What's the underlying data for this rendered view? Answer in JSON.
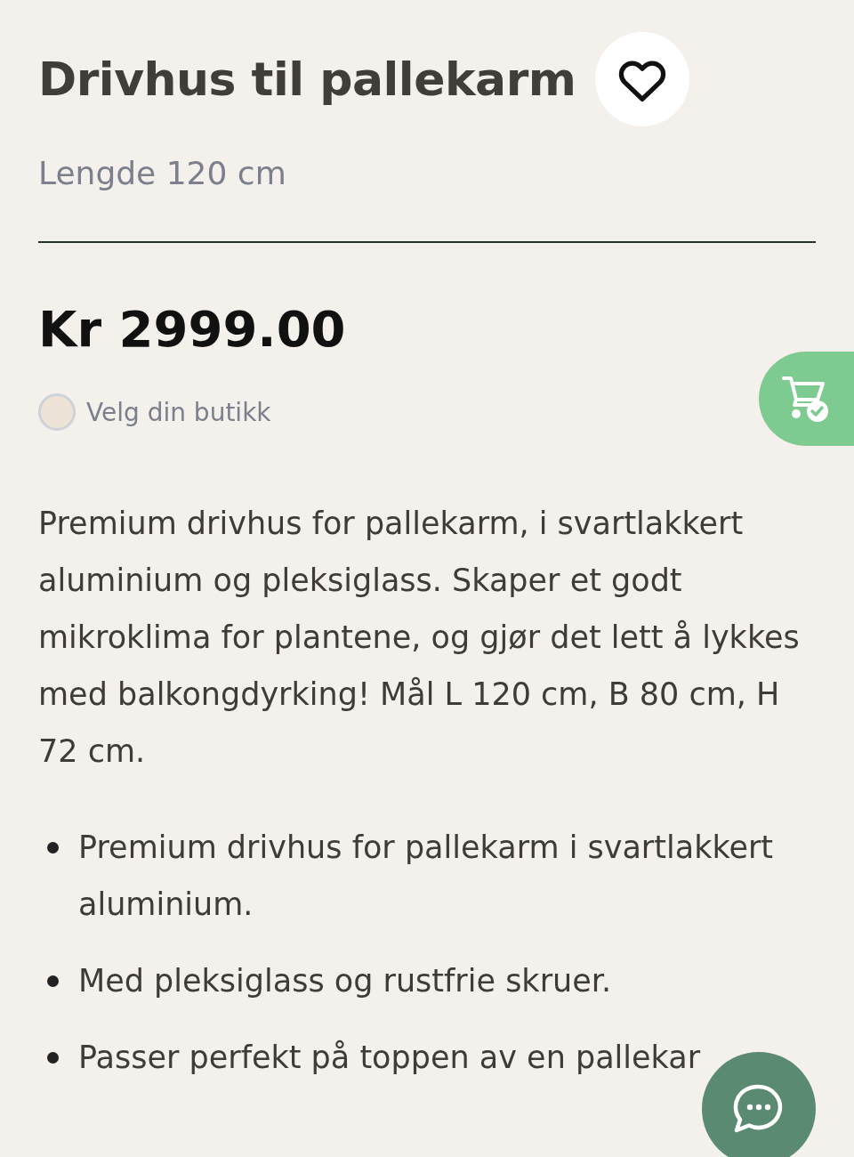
{
  "product": {
    "title": "Drivhus til pallekarm",
    "subtitle": "Lengde 120 cm",
    "price": "Kr 2999.00"
  },
  "store": {
    "label": "Velg din butikk",
    "selected": false
  },
  "description": "Premium drivhus for pallekarm, i svartlakkert aluminium og pleksiglass. Skaper et godt mikroklima for plantene, og gjør det lett å lykkes med balkongdyrking! Mål L 120 cm, B 80 cm, H 72 cm.",
  "features": [
    "Premium drivhus for pallekarm i svartlakkert aluminium.",
    "Med pleksiglass og rustfrie skruer.",
    "Passer perfekt på toppen av en pallekar"
  ]
}
